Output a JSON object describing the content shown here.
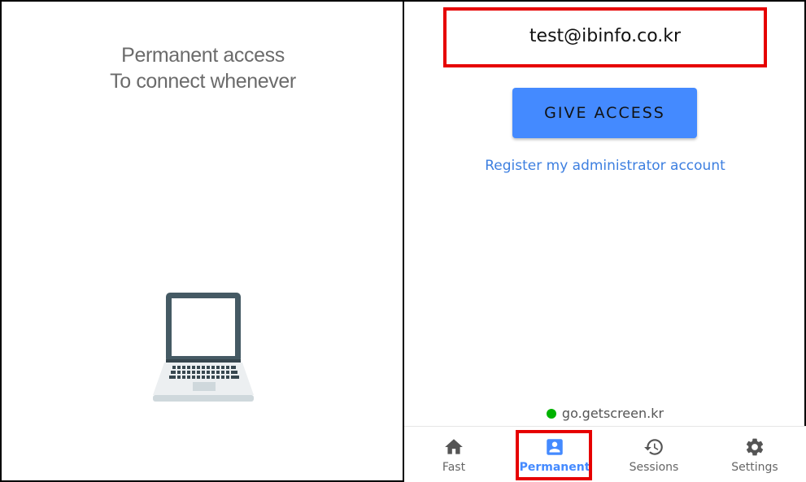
{
  "left": {
    "heading_line_1": "Permanent access",
    "heading_line_2": "To connect whenever",
    "illustration_icon": "laptop-icon"
  },
  "right": {
    "email_value": "test@ibinfo.co.kr",
    "give_access_label": "GIVE ACCESS",
    "register_link_label": "Register my administrator account",
    "server_status": {
      "text": "go.getscreen.kr",
      "dot_color": "#00b300"
    }
  },
  "bottom_nav": {
    "items": [
      {
        "label": "Fast",
        "icon": "home-icon",
        "active": false
      },
      {
        "label": "Permanent",
        "icon": "account-box-icon",
        "active": true
      },
      {
        "label": "Sessions",
        "icon": "history-icon",
        "active": false
      },
      {
        "label": "Settings",
        "icon": "gear-icon",
        "active": false
      }
    ]
  },
  "colors": {
    "accent": "#448aff",
    "link": "#3d7fe0",
    "highlight": "#e60000",
    "laptop_frame": "#455a64"
  }
}
